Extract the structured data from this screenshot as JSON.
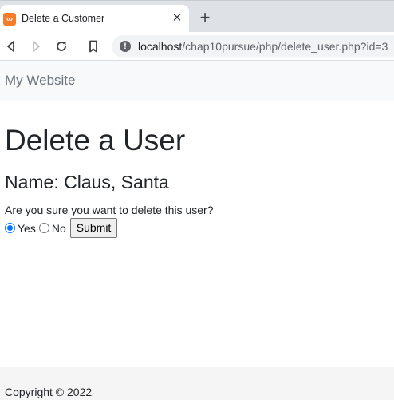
{
  "browser": {
    "tab": {
      "favicon": "xampp-icon",
      "title": "Delete a Customer",
      "close_icon": "close-icon"
    },
    "new_tab_icon": "plus-icon",
    "nav": {
      "back_icon": "back-icon",
      "forward_icon": "forward-icon",
      "reload_icon": "reload-icon",
      "bookmark_icon": "bookmark-icon"
    },
    "address_bar": {
      "security_icon": "info-icon",
      "host": "localhost",
      "path": "/chap10pursue/php/delete_user.php?id=3"
    }
  },
  "navbar": {
    "brand": "My Website"
  },
  "main": {
    "title": "Delete a User",
    "name_line": "Name: Claus, Santa",
    "question": "Are you sure you want to delete this user?",
    "options": [
      {
        "label": "Yes",
        "checked": true
      },
      {
        "label": "No",
        "checked": false
      }
    ],
    "submit_label": "Submit"
  },
  "footer": {
    "copyright": "Copyright © 2022"
  },
  "colors": {
    "radio_accent": "#0075ff",
    "navbar_bg": "#f8f9fa",
    "footer_bg": "#f5f5f5",
    "brand_text": "#6c757d",
    "favicon": "#f57c2b"
  }
}
